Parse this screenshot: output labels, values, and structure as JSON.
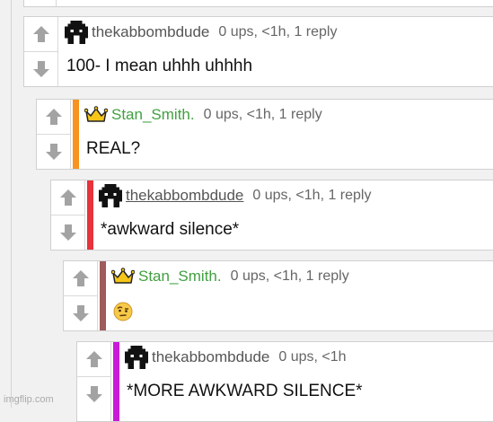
{
  "comments": [
    {
      "username": "thekabbombdude",
      "stats": "0 ups, <1h, 1 reply",
      "text": "100- I mean uhhh uhhhh",
      "bar_color": ""
    },
    {
      "username": "Stan_Smith.",
      "stats": "0 ups, <1h, 1 reply",
      "text": "REAL?",
      "bar_color": "#f7931e"
    },
    {
      "username": "thekabbombdude",
      "stats": "0 ups, <1h, 1 reply",
      "text": "*awkward silence*",
      "bar_color": "#e8323c"
    },
    {
      "username": "Stan_Smith.",
      "stats": "0 ups, <1h, 1 reply",
      "text": "",
      "bar_color": "#9e5b5b"
    },
    {
      "username": "thekabbombdude",
      "stats": "0 ups, <1h",
      "text": "*MORE AWKWARD SILENCE*",
      "bar_color": "#c91ad6"
    }
  ],
  "icons": {
    "upvote": "up-arrow-icon",
    "downvote": "down-arrow-icon",
    "user_avatar": "pixel-avatar-icon",
    "mod_badge": "crown-icon",
    "emoji": "raised-eyebrow-emoji"
  },
  "colors": {
    "username_green": "#41a041",
    "background": "#f1f1f1"
  },
  "watermark": "imgflip.com"
}
